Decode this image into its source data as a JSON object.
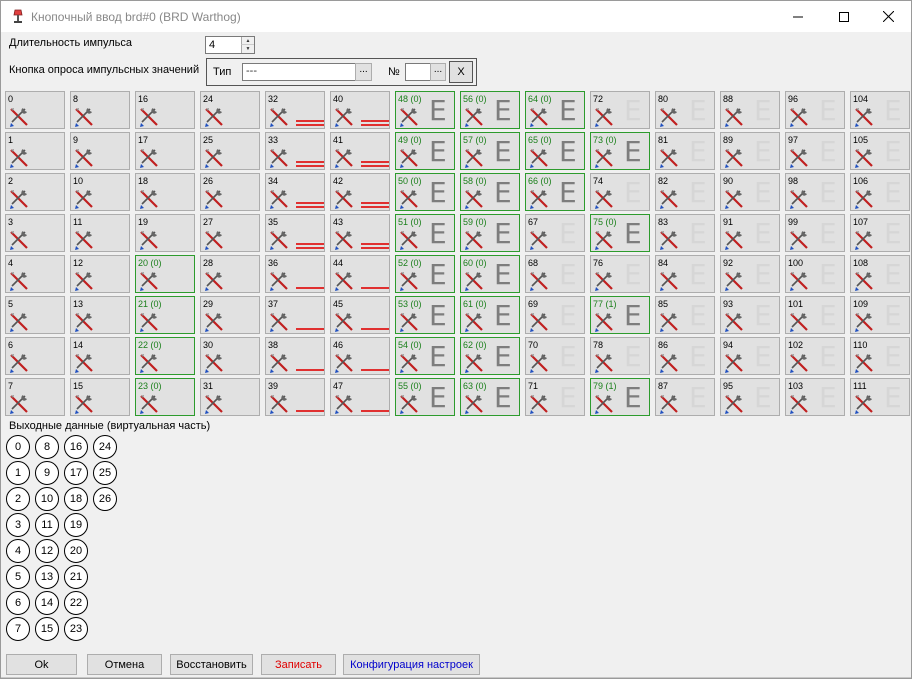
{
  "window": {
    "title": "Кнопочный ввод brd#0 (BRD Warthog)",
    "icon": "lamp-icon"
  },
  "pulse": {
    "label": "Длительность импульса",
    "value": "4"
  },
  "poll": {
    "label": "Кнопка опроса импульсных значений",
    "type_label": "Тип",
    "type_value": "---",
    "browse": "...",
    "num_label": "№",
    "num_value": "",
    "clear": "X"
  },
  "buttons": {
    "rows": [
      [
        "0",
        "8",
        "16",
        "24",
        "32",
        "40",
        "48 (0)",
        "56 (0)",
        "64 (0)",
        "72",
        "80",
        "88",
        "96",
        "104"
      ],
      [
        "1",
        "9",
        "17",
        "25",
        "33",
        "41",
        "49 (0)",
        "57 (0)",
        "65 (0)",
        "73 (0)",
        "81",
        "89",
        "97",
        "105"
      ],
      [
        "2",
        "10",
        "18",
        "26",
        "34",
        "42",
        "50 (0)",
        "58 (0)",
        "66 (0)",
        "74",
        "82",
        "90",
        "98",
        "106"
      ],
      [
        "3",
        "11",
        "19",
        "27",
        "35",
        "43",
        "51 (0)",
        "59 (0)",
        "67",
        "75 (0)",
        "83",
        "91",
        "99",
        "107"
      ],
      [
        "4",
        "12",
        "20 (0)",
        "28",
        "36",
        "44",
        "52 (0)",
        "60 (0)",
        "68",
        "76",
        "84",
        "92",
        "100",
        "108"
      ],
      [
        "5",
        "13",
        "21 (0)",
        "29",
        "37",
        "45",
        "53 (0)",
        "61 (0)",
        "69",
        "77 (1)",
        "85",
        "93",
        "101",
        "109"
      ],
      [
        "6",
        "14",
        "22 (0)",
        "30",
        "38",
        "46",
        "54 (0)",
        "62 (0)",
        "70",
        "78",
        "86",
        "94",
        "102",
        "110"
      ],
      [
        "7",
        "15",
        "23 (0)",
        "31",
        "39",
        "47",
        "55 (0)",
        "63 (0)",
        "71",
        "79 (1)",
        "87",
        "95",
        "103",
        "111"
      ]
    ],
    "e_glyph": "E",
    "tool_icon": "tools-icon",
    "colors": {
      "assigned_border": "#2d9b2d",
      "assigned_text": "#1a7f1a",
      "bar": "#e03030"
    }
  },
  "output": {
    "label": "Выходные данные (виртуальная часть)",
    "columns": [
      [
        "0",
        "1",
        "2",
        "3",
        "4",
        "5",
        "6",
        "7"
      ],
      [
        "8",
        "9",
        "10",
        "11",
        "12",
        "13",
        "14",
        "15"
      ],
      [
        "16",
        "17",
        "18",
        "19",
        "20",
        "21",
        "22",
        "23"
      ],
      [
        "24",
        "25",
        "26"
      ]
    ]
  },
  "footer": {
    "ok": "Ok",
    "cancel": "Отмена",
    "restore": "Восстановить",
    "write": "Записать",
    "config": "Конфигурация настроек",
    "write_color": "#e00000",
    "config_color": "#0000cc"
  }
}
